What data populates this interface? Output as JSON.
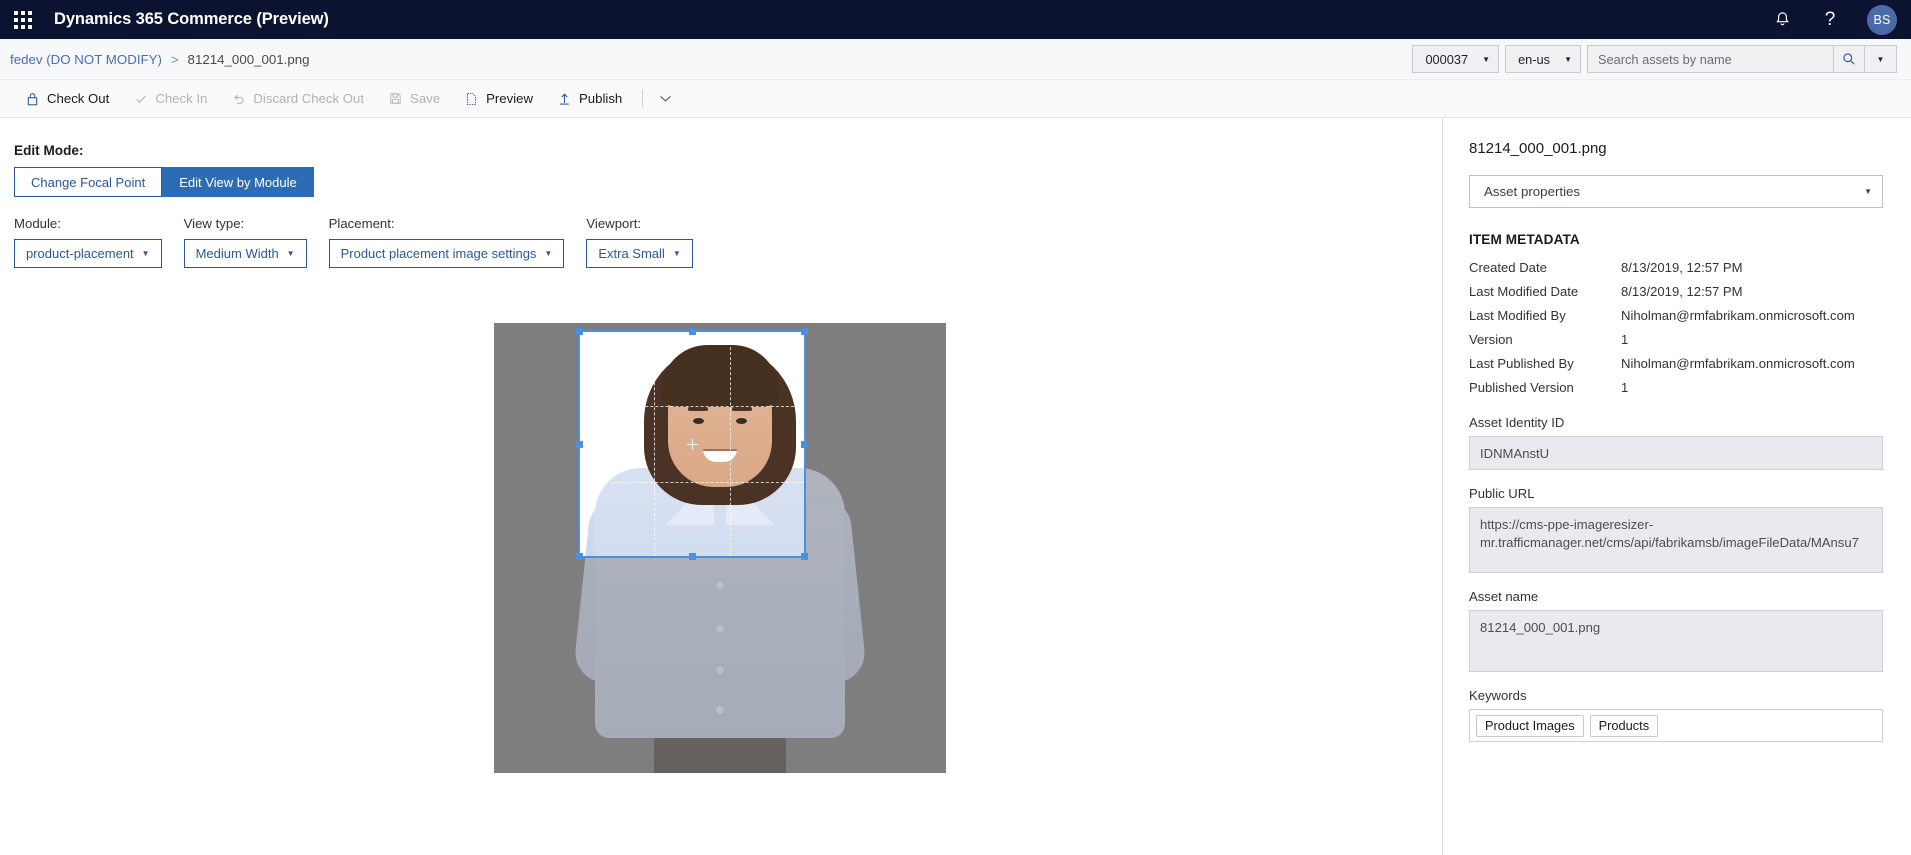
{
  "appbar": {
    "waffle_icon": "app-launcher-icon",
    "title": "Dynamics 365 Commerce (Preview)",
    "bell_icon": "notifications-bell-icon",
    "help_icon": "help-question-icon",
    "help_glyph": "?",
    "avatar_initials": "BS"
  },
  "breadcrumb": {
    "root": "fedev (DO NOT MODIFY)",
    "separator": ">",
    "current": "81214_000_001.png"
  },
  "topcontrols": {
    "channel_value": "000037",
    "locale_value": "en-us",
    "search_placeholder": "Search assets by name",
    "search_value": "",
    "search_icon": "search-magnifier-icon",
    "search_more_icon": "chevron-down-icon",
    "caret": "▼"
  },
  "toolbar": {
    "items": [
      {
        "label": "Check Out",
        "icon": "lock-icon",
        "disabled": false
      },
      {
        "label": "Check In",
        "icon": "checkmark-icon",
        "disabled": true
      },
      {
        "label": "Discard Check Out",
        "icon": "undo-arrow-icon",
        "disabled": true
      },
      {
        "label": "Save",
        "icon": "floppy-disk-icon",
        "disabled": true
      },
      {
        "label": "Preview",
        "icon": "page-preview-icon",
        "disabled": false
      },
      {
        "label": "Publish",
        "icon": "upload-arrow-icon",
        "disabled": false
      }
    ],
    "overflow_icon": "chevron-down-icon"
  },
  "editmode": {
    "label": "Edit Mode:",
    "buttons": [
      {
        "label": "Change Focal Point",
        "selected": false
      },
      {
        "label": "Edit View by Module",
        "selected": true
      }
    ]
  },
  "selectors": [
    {
      "label": "Module:",
      "value": "product-placement"
    },
    {
      "label": "View type:",
      "value": "Medium Width"
    },
    {
      "label": "Placement:",
      "value": "Product placement image settings"
    },
    {
      "label": "Viewport:",
      "value": "Extra Small"
    }
  ],
  "canvas": {
    "name": "image-crop-canvas",
    "crop_handles": 8,
    "focal_point_icon": "focal-point-crosshair-icon"
  },
  "panel": {
    "title": "81214_000_001.png",
    "properties_select": "Asset properties",
    "section_title": "ITEM METADATA",
    "metadata": [
      {
        "key": "Created Date",
        "value": "8/13/2019, 12:57 PM"
      },
      {
        "key": "Last Modified Date",
        "value": "8/13/2019, 12:57 PM"
      },
      {
        "key": "Last Modified By",
        "value": "Niholman@rmfabrikam.onmicrosoft.com"
      },
      {
        "key": "Version",
        "value": "1"
      },
      {
        "key": "Last Published By",
        "value": "Niholman@rmfabrikam.onmicrosoft.com"
      },
      {
        "key": "Published Version",
        "value": "1"
      }
    ],
    "asset_identity_label": "Asset Identity ID",
    "asset_identity_value": "IDNMAnstU",
    "public_url_label": "Public URL",
    "public_url_value": "https://cms-ppe-imageresizer-mr.trafficmanager.net/cms/api/fabrikamsb/imageFileData/MAnsu7",
    "asset_name_label": "Asset name",
    "asset_name_value": "81214_000_001.png",
    "keywords_label": "Keywords",
    "keywords": [
      "Product Images",
      "Products"
    ]
  },
  "colors": {
    "appbar_bg": "#0b1330",
    "accent_blue": "#2b579a",
    "primary_button": "#2b6cb4",
    "crop_blue": "#4a90e2",
    "canvas_shade": "#7f7f7f"
  }
}
